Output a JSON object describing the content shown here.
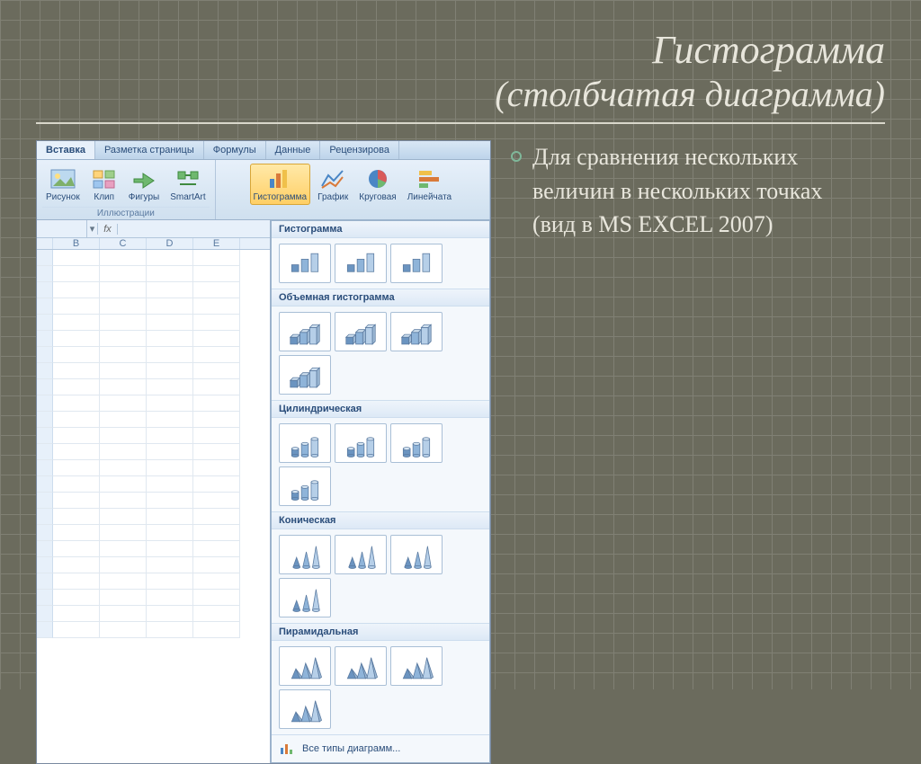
{
  "title": {
    "line1": "Гистограмма",
    "line2": "(столбчатая диаграмма)"
  },
  "bullet": {
    "text1": "Для сравнения нескольких величин в нескольких точках",
    "text2": "(вид в MS EXCEL 2007)"
  },
  "excel": {
    "tabs": [
      "Вставка",
      "Разметка страницы",
      "Формулы",
      "Данные",
      "Рецензирова"
    ],
    "groups": {
      "illustrations": {
        "title": "Иллюстрации",
        "buttons": [
          {
            "id": "picture",
            "label": "Рисунок"
          },
          {
            "id": "clip",
            "label": "Клип"
          },
          {
            "id": "shapes",
            "label": "Фигуры"
          },
          {
            "id": "smartart",
            "label": "SmartArt"
          }
        ]
      },
      "charts": {
        "buttons": [
          {
            "id": "column",
            "label": "Гистограмма",
            "active": true
          },
          {
            "id": "line",
            "label": "График"
          },
          {
            "id": "pie",
            "label": "Круговая"
          },
          {
            "id": "bar",
            "label": "Линейчата"
          }
        ]
      }
    },
    "columns": [
      "B",
      "C",
      "D",
      "E"
    ],
    "gallery": {
      "sections": [
        {
          "title": "Гистограмма",
          "count": 3,
          "style": "2d"
        },
        {
          "title": "Объемная гистограмма",
          "count": 4,
          "style": "3d"
        },
        {
          "title": "Цилиндрическая",
          "count": 4,
          "style": "cyl"
        },
        {
          "title": "Коническая",
          "count": 4,
          "style": "cone"
        },
        {
          "title": "Пирамидальная",
          "count": 4,
          "style": "pyr"
        }
      ],
      "footer": "Все типы диаграмм..."
    }
  }
}
